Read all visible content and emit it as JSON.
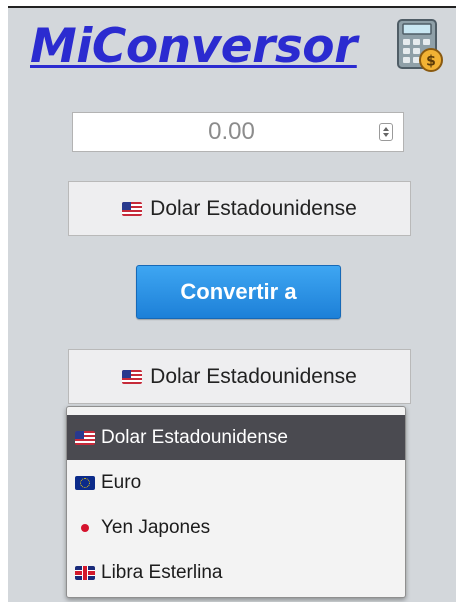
{
  "brand": {
    "title": "MiConversor",
    "icon": "calculator-money-icon"
  },
  "amount": {
    "value": "",
    "placeholder": "0.00"
  },
  "from_currency": {
    "selected": "Dolar Estadounidense",
    "flag": "us-flag-icon"
  },
  "convert_button": {
    "label": "Convertir a"
  },
  "to_currency": {
    "selected": "Dolar Estadounidense",
    "flag": "us-flag-icon",
    "options": [
      {
        "label": "Dolar Estadounidense",
        "flag": "us-flag-icon",
        "selected": true
      },
      {
        "label": "Euro",
        "flag": "eu-flag-icon",
        "selected": false
      },
      {
        "label": "Yen Japones",
        "flag": "jp-flag-icon",
        "selected": false
      },
      {
        "label": "Libra Esterlina",
        "flag": "uk-flag-icon",
        "selected": false
      }
    ]
  },
  "colors": {
    "brand_text": "#2b2bd0",
    "background": "#d3d7db",
    "convert_button": "#1d80d8",
    "selected_option": "#4a4a50"
  }
}
